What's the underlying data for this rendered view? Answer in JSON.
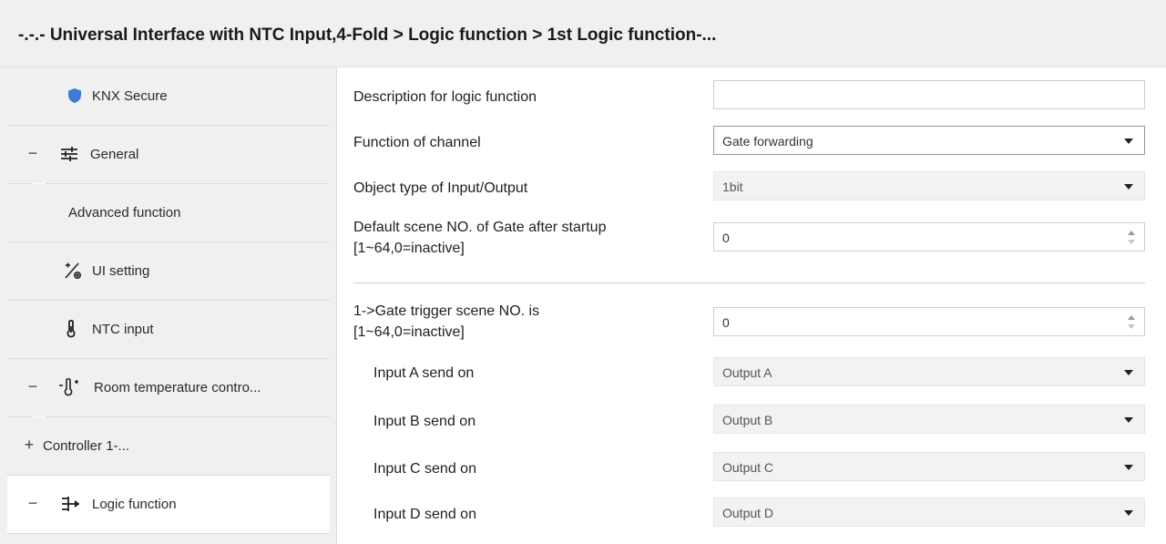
{
  "header": {
    "title": "-.-.- Universal Interface with NTC Input,4-Fold > Logic function > 1st Logic function-..."
  },
  "sidebar": {
    "items": [
      {
        "label": "KNX Secure",
        "icon": "shield-icon"
      },
      {
        "label": "General",
        "icon": "sliders-icon",
        "expander": "−"
      },
      {
        "label": "Advanced function"
      },
      {
        "label": "UI setting",
        "icon": "ui-setting-icon"
      },
      {
        "label": "NTC input",
        "icon": "thermometer-icon"
      },
      {
        "label": "Room temperature contro...",
        "icon": "room-thermometer-icon",
        "expander": "−"
      },
      {
        "label": "Controller 1-...",
        "expander": "+"
      },
      {
        "label": "Logic function",
        "icon": "logic-gate-icon",
        "expander": "−"
      }
    ]
  },
  "params": {
    "description": {
      "label": "Description for logic function",
      "value": ""
    },
    "function_channel": {
      "label": "Function of channel",
      "value": "Gate forwarding"
    },
    "object_type": {
      "label": "Object type of Input/Output",
      "value": "1bit"
    },
    "default_scene": {
      "label1": "Default scene NO. of Gate after startup",
      "label2": "[1~64,0=inactive]",
      "value": "0"
    },
    "gate_trigger": {
      "label1": "1->Gate trigger scene NO. is",
      "label2": "[1~64,0=inactive]",
      "value": "0"
    },
    "inputs": [
      {
        "label": "Input A send on",
        "value": "Output A"
      },
      {
        "label": "Input B send on",
        "value": "Output B"
      },
      {
        "label": "Input C send on",
        "value": "Output C"
      },
      {
        "label": "Input D send on",
        "value": "Output D"
      }
    ]
  },
  "colors": {
    "shield": "#3d7bd6",
    "selected_bg": "#ffffff",
    "sidebar_bg": "#f0f0f0"
  }
}
